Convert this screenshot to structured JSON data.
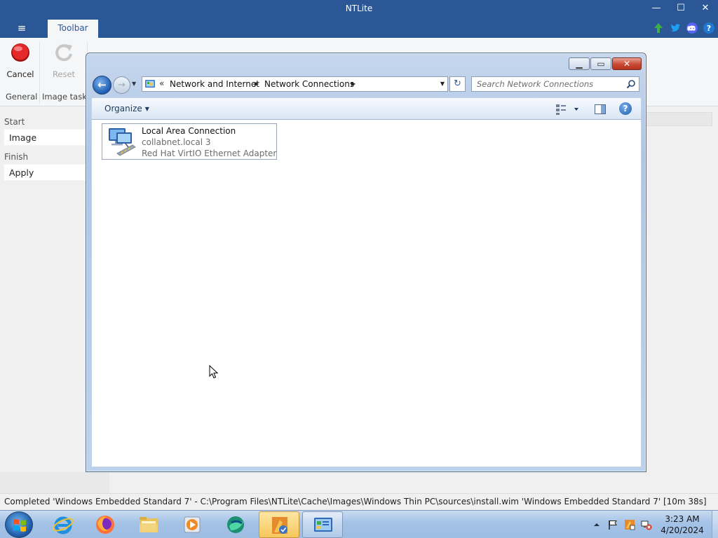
{
  "app": {
    "title": "NTLite",
    "window_buttons": {
      "minimize": "—",
      "maximize": "☐",
      "close": "✕"
    }
  },
  "ribbon": {
    "menu_icon": "≡",
    "tab": "Toolbar",
    "buttons": [
      {
        "label": "Cancel",
        "icon": "record-icon"
      },
      {
        "label": "Reset",
        "icon": "refresh-icon"
      }
    ],
    "groups": [
      "General",
      "Image tasks"
    ],
    "social_icons": [
      "update-arrow-icon",
      "twitter-icon",
      "discord-icon",
      "help-icon"
    ]
  },
  "left_nav": {
    "categories": [
      {
        "title": "Start",
        "items": [
          "Image"
        ]
      },
      {
        "title": "Finish",
        "items": [
          "Apply"
        ]
      }
    ]
  },
  "status_bar": {
    "text": "Completed  'Windows Embedded Standard 7' - C:\\Program Files\\NTLite\\Cache\\Images\\Windows Thin PC\\sources\\install.wim 'Windows Embedded Standard 7' [10m 38s]"
  },
  "explorer": {
    "caption_buttons": {
      "minimize": "▁",
      "maximize": "▭",
      "close": "✕"
    },
    "address": {
      "overflow": "«",
      "crumbs": [
        "Network and Internet",
        "Network Connections"
      ]
    },
    "search": {
      "placeholder": "Search Network Connections"
    },
    "command_bar": {
      "organize": "Organize",
      "help": "?"
    },
    "connections": [
      {
        "name": "Local Area Connection",
        "status": "collabnet.local  3",
        "adapter": "Red Hat VirtIO Ethernet Adapter"
      }
    ]
  },
  "taskbar": {
    "apps": [
      "internet-explorer-icon",
      "firefox-icon",
      "file-explorer-icon",
      "media-player-icon",
      "browser-globe-icon",
      "ntlite-icon",
      "control-panel-icon"
    ],
    "clock": {
      "time": "3:23 AM",
      "date": "4/20/2024"
    },
    "tray": [
      "show-hidden-icons",
      "action-center-flag-icon",
      "ntlite-tray-icon",
      "network-disconnected-icon"
    ]
  },
  "colors": {
    "ntlite_blue": "#2b5797",
    "explorer_frame": "#b9cfea",
    "taskbar": "#a4c2e6"
  }
}
